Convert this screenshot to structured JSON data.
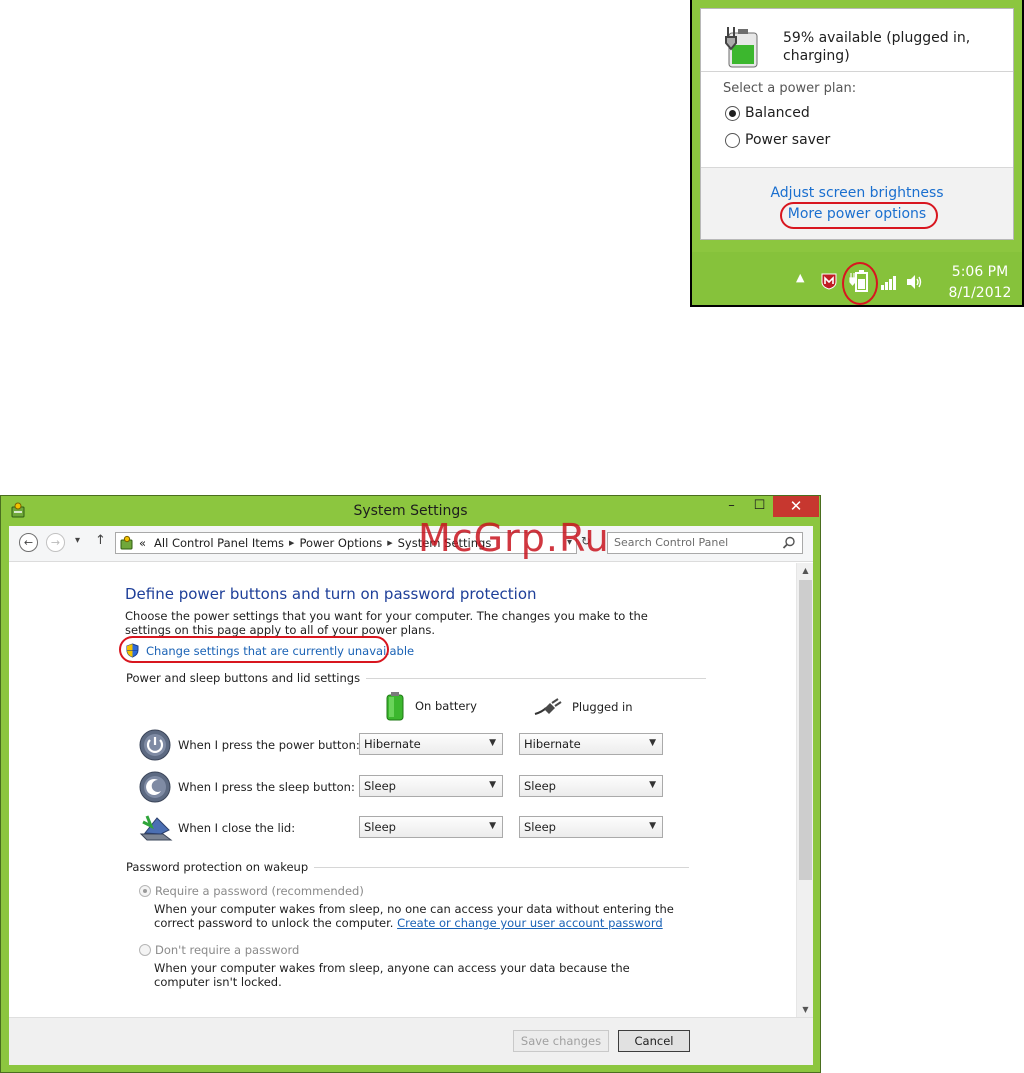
{
  "flyout": {
    "battery_status": "59% available (plugged in, charging)",
    "plan_heading": "Select a power plan:",
    "plans": [
      {
        "label": "Balanced",
        "selected": true
      },
      {
        "label": "Power saver",
        "selected": false
      }
    ],
    "link_brightness": "Adjust screen brightness",
    "link_more_power": "More power options"
  },
  "taskbar": {
    "time": "5:06 PM",
    "date": "8/1/2012",
    "chevron": "▲",
    "tray_icons": [
      "mcafee-icon",
      "battery-icon",
      "network-icon",
      "speaker-icon"
    ]
  },
  "window": {
    "title": "System Settings",
    "controls": {
      "minimize": "–",
      "maximize": "☐",
      "close": "✕"
    },
    "nav": {
      "back": "←",
      "forward": "→",
      "recent": "▾",
      "up": "↑"
    },
    "address": {
      "prefix": "«",
      "crumbs": [
        "All Control Panel Items",
        "Power Options",
        "System Settings"
      ]
    },
    "search_placeholder": "Search Control Panel",
    "heading": "Define power buttons and turn on password protection",
    "description": "Choose the power settings that you want for your computer. The changes you make to the settings on this page apply to all of your power plans.",
    "admin_link": "Change settings that are currently unavailable",
    "group_power": "Power and sleep buttons and lid settings",
    "col_battery": "On battery",
    "col_plugged": "Plugged in",
    "rows": [
      {
        "label": "When I press the power button:",
        "battery": "Hibernate",
        "plugged": "Hibernate"
      },
      {
        "label": "When I press the sleep button:",
        "battery": "Sleep",
        "plugged": "Sleep"
      },
      {
        "label": "When I close the lid:",
        "battery": "Sleep",
        "plugged": "Sleep"
      }
    ],
    "group_password": "Password protection on wakeup",
    "pw_options": [
      {
        "label": "Require a password (recommended)",
        "selected": true,
        "desc": "When your computer wakes from sleep, no one can access your data without entering the correct password to unlock the computer.",
        "link": "Create or change your user account password"
      },
      {
        "label": "Don't require a password",
        "selected": false,
        "desc": "When your computer wakes from sleep, anyone can access your data because the computer isn't locked."
      }
    ],
    "save_label": "Save changes",
    "cancel_label": "Cancel"
  },
  "watermark": "McGrp.Ru",
  "colors": {
    "accent_green": "#8cc63f",
    "highlight_red": "#d8161f",
    "link_blue": "#1a62b5"
  }
}
